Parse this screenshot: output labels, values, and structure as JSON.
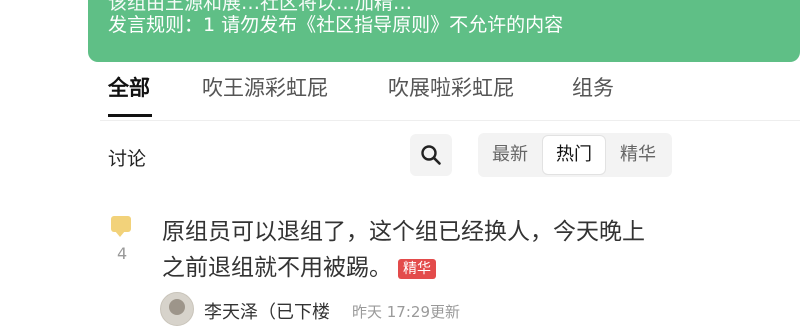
{
  "notice": {
    "line1": "该组由王源和展…社区将以…加精…",
    "line2": "发言规则：1 请勿发布《社区指导原则》不允许的内容"
  },
  "tabs": [
    "全部",
    "吹王源彩虹屁",
    "吹展啦彩虹屁",
    "组务"
  ],
  "discussion": {
    "title": "讨论",
    "sort_options": [
      "最新",
      "热门",
      "精华"
    ],
    "selected_sort": "热门"
  },
  "post": {
    "comment_count": "4",
    "title": "原组员可以退组了，这个组已经换人，今天晚上之前退组就不用被踢。",
    "badge": "精华",
    "author": "李天泽（已下楼",
    "time": "昨天 17:29更新"
  },
  "colors": {
    "notice_bg": "#5fbf86",
    "badge_bg": "#e34b4b",
    "comment_icon": "#f2d27a"
  },
  "icons": {
    "search": "search-icon",
    "comment": "comment-icon"
  }
}
